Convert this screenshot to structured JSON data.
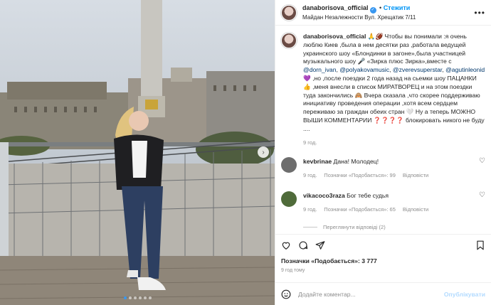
{
  "header": {
    "username": "danaborisova_official",
    "follow_label": "Стежити",
    "location": "Майдан Незалежности Вул. Хрещатик 7/11"
  },
  "caption": {
    "username": "danaborisova_official",
    "p1": "🙏🏈 Чтобы вы понимали :я очень люблю Киев ,была в нем десятки раз ,работала ведущей украинского шоу «Блондинки в загоне»,была участницей музыкального шоу 🎤 «Зирка плюс Зирка»,вместе с",
    "m1": "@dorn_ivan",
    "p2": ",",
    "m2": "@polyakovamusic",
    "p3": ",",
    "m3": "@zverevsuperstar",
    "p4": ",",
    "m4": "@agutinleonid",
    "p5": "💜 ,но ,после поездки 2 года назад на сьемки шоу ПАЦАНКИ 👍 ,меня внесли в список МИРАТВОРЕЦ и на этом поездки туда закончились 🙈 Вчера сказала ,что скорее поддерживаю инициативу проведения операции ,хотя всем сердцем переживаю за граждан обеих стран 🤍 Ну а теперь МОЖНО ВЫШИ КОММЕНТАРИИ ❓❓❓❓ блокировать никого не буду ....",
    "time": "9 год."
  },
  "comments": [
    {
      "username": "kevbrinae",
      "text": "Дана! Молодец!",
      "time": "9 год.",
      "likes": "Позначки «Подобається»: 99",
      "reply": "Відповісти",
      "avatar_color": "#6d6d6d"
    },
    {
      "username": "vikacoco3raza",
      "text": "Бог тебе судья",
      "time": "9 год.",
      "likes": "Позначки «Подобається»: 65",
      "reply": "Відповісти",
      "avatar_color": "#4f6b3a"
    }
  ],
  "view_replies": "Переглянути відповіді (2)",
  "actions": {
    "likes": "Позначки «Подобається»: 3 777",
    "posted": "9 год тому"
  },
  "add_comment": {
    "placeholder": "Додайте коментар...",
    "post_label": "Опублікувати"
  },
  "carousel": {
    "slides": 6,
    "active": 1
  },
  "colors": {
    "accent": "#0095f6",
    "verified": "#3897f0",
    "text": "#262626",
    "muted": "#8e8e8e"
  }
}
